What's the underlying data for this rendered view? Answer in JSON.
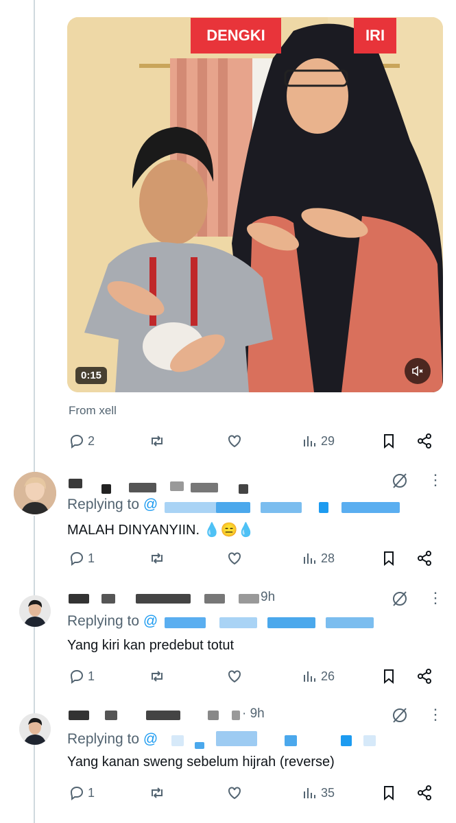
{
  "video": {
    "tags": [
      "DENGKI",
      "IRI"
    ],
    "duration": "0:15",
    "attribution": "From xell",
    "colors": {
      "tag": "#e8343a",
      "wall": "#eed8a6"
    }
  },
  "main_actions": {
    "replies": "2",
    "views": "29"
  },
  "replies": [
    {
      "time": "",
      "replying_prefix": "Replying to",
      "at": "@",
      "text": "MALAH DINYANYIIN. 💧😑💧",
      "reply_count": "1",
      "views": "28"
    },
    {
      "time": "9h",
      "replying_prefix": "Replying to",
      "at": "@",
      "text": "Yang kiri kan predebut totut",
      "reply_count": "1",
      "views": "26"
    },
    {
      "time": "· 9h",
      "replying_prefix": "Replying to",
      "at": "@",
      "text": "Yang kanan sweng sebelum hijrah (reverse)",
      "reply_count": "1",
      "views": "35"
    }
  ],
  "icons": [
    "reply-icon",
    "retweet-icon",
    "like-icon",
    "views-icon",
    "bookmark-icon",
    "share-icon",
    "grok-icon",
    "more-icon",
    "mute-icon"
  ]
}
